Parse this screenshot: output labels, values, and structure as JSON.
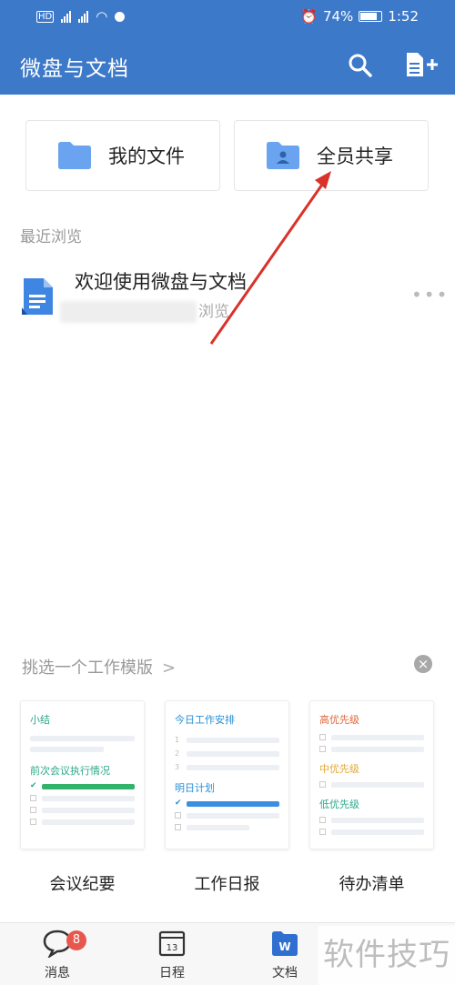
{
  "statusbar": {
    "battery": "74%",
    "time": "1:52"
  },
  "appbar": {
    "title": "微盘与文档"
  },
  "folders": {
    "mine": "我的文件",
    "shared": "全员共享"
  },
  "recent": {
    "label": "最近浏览",
    "item": {
      "name": "欢迎使用微盘与文档",
      "meta": "浏览"
    }
  },
  "templates": {
    "header": "挑选一个工作模版",
    "close": "×",
    "cards": [
      {
        "name": "会议纪要",
        "h1": "小结",
        "h2": "前次会议执行情况"
      },
      {
        "name": "工作日报",
        "h1": "今日工作安排",
        "h2": "明日计划"
      },
      {
        "name": "待办清单",
        "h1": "高优先级",
        "h2": "中优先级",
        "h3": "低优先级"
      }
    ]
  },
  "nav": {
    "messages": "消息",
    "messages_badge": "8",
    "calendar": "日程",
    "calendar_day": "13",
    "docs": "文档"
  },
  "watermark": "软件技巧",
  "colors": {
    "primary": "#3d79c9",
    "folder": "#6aa3ef",
    "badge": "#e8574e",
    "arrow": "#d9322b"
  }
}
